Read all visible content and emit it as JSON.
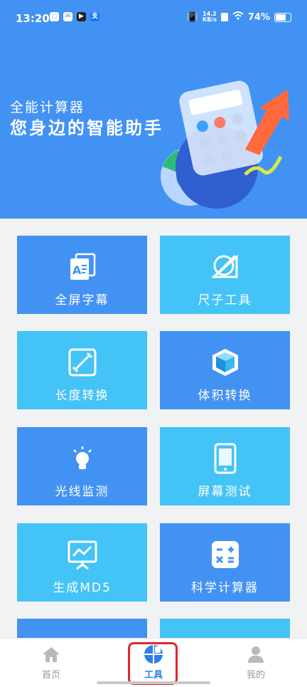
{
  "status_bar": {
    "time": "13:20",
    "app_icons": [
      "circle-app-icon",
      "mail-icon",
      "play-icon",
      "alipay-icon"
    ],
    "net_speed_value": "14.2",
    "net_speed_unit": "KB/s",
    "battery_percent": "74%"
  },
  "header": {
    "title": "全能计算器",
    "subtitle": "您身边的智能助手"
  },
  "tiles": [
    {
      "label": "全屏字幕",
      "icon": "subtitle-icon",
      "color": "#4292f4"
    },
    {
      "label": "尺子工具",
      "icon": "ruler-icon",
      "color": "#44c3f7"
    },
    {
      "label": "长度转换",
      "icon": "length-icon",
      "color": "#44c3f7"
    },
    {
      "label": "体积转换",
      "icon": "cube-icon",
      "color": "#4292f4"
    },
    {
      "label": "光线监测",
      "icon": "bulb-icon",
      "color": "#4292f4"
    },
    {
      "label": "屏幕测试",
      "icon": "phone-screen-icon",
      "color": "#44c3f7"
    },
    {
      "label": "生成MD5",
      "icon": "presentation-icon",
      "color": "#44c3f7"
    },
    {
      "label": "科学计算器",
      "icon": "calculator-icon",
      "color": "#4292f4"
    }
  ],
  "bottom_nav": {
    "home": "首页",
    "tools": "工具",
    "mine": "我的"
  },
  "colors": {
    "primary": "#4292f4",
    "light": "#44c3f7",
    "active_nav": "#2f7fe6",
    "highlight": "#e0262d"
  }
}
